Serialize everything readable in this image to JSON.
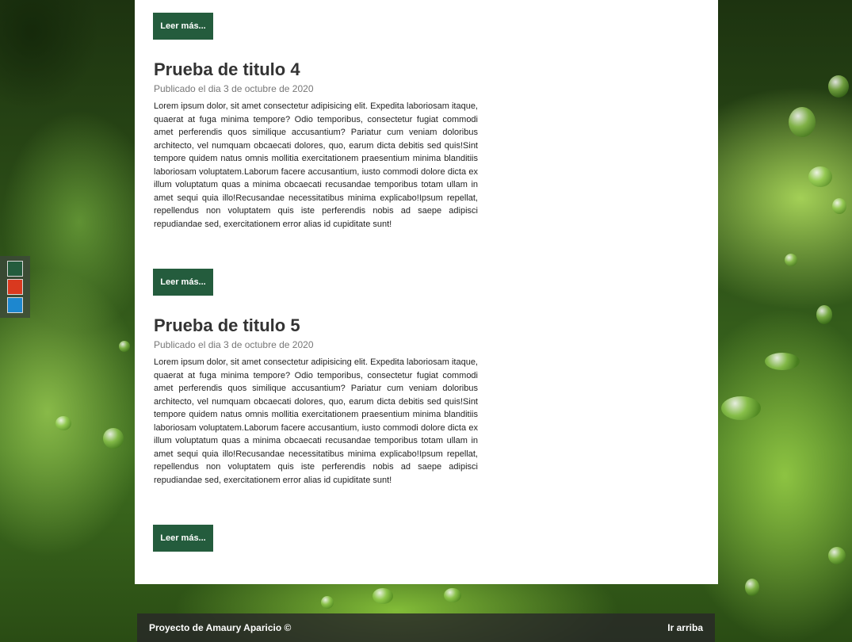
{
  "palette": {
    "colors": [
      "#245c3d",
      "#d9391f",
      "#1d87cf"
    ]
  },
  "top_read_more": "Leer más...",
  "posts": [
    {
      "title": "Prueba de titulo 4",
      "date": "Publicado el dia 3 de octubre de 2020",
      "body": "Lorem ipsum dolor, sit amet consectetur adipisicing elit. Expedita laboriosam itaque, quaerat at fuga minima tempore? Odio temporibus, consectetur fugiat commodi amet perferendis quos similique accusantium? Pariatur cum veniam doloribus architecto, vel numquam obcaecati dolores, quo, earum dicta debitis sed quis!Sint tempore quidem natus omnis mollitia exercitationem praesentium minima blanditiis laboriosam voluptatem.Laborum facere accusantium, iusto commodi dolore dicta ex illum voluptatum quas a minima obcaecati recusandae temporibus totam ullam in amet sequi quia illo!Recusandae necessitatibus minima explicabo!Ipsum repellat, repellendus non voluptatem quis iste perferendis nobis ad saepe adipisci repudiandae sed, exercitationem error alias id cupiditate sunt!",
      "read_more": "Leer más..."
    },
    {
      "title": "Prueba de titulo 5",
      "date": "Publicado el dia 3 de octubre de 2020",
      "body": "Lorem ipsum dolor, sit amet consectetur adipisicing elit. Expedita laboriosam itaque, quaerat at fuga minima tempore? Odio temporibus, consectetur fugiat commodi amet perferendis quos similique accusantium? Pariatur cum veniam doloribus architecto, vel numquam obcaecati dolores, quo, earum dicta debitis sed quis!Sint tempore quidem natus omnis mollitia exercitationem praesentium minima blanditiis laboriosam voluptatem.Laborum facere accusantium, iusto commodi dolore dicta ex illum voluptatum quas a minima obcaecati recusandae temporibus totam ullam in amet sequi quia illo!Recusandae necessitatibus minima explicabo!Ipsum repellat, repellendus non voluptatem quis iste perferendis nobis ad saepe adipisci repudiandae sed, exercitationem error alias id cupiditate sunt!",
      "read_more": "Leer más..."
    }
  ],
  "footer": {
    "credit": "Proyecto de Amaury Aparicio ©",
    "back_to_top": "Ir arriba"
  }
}
